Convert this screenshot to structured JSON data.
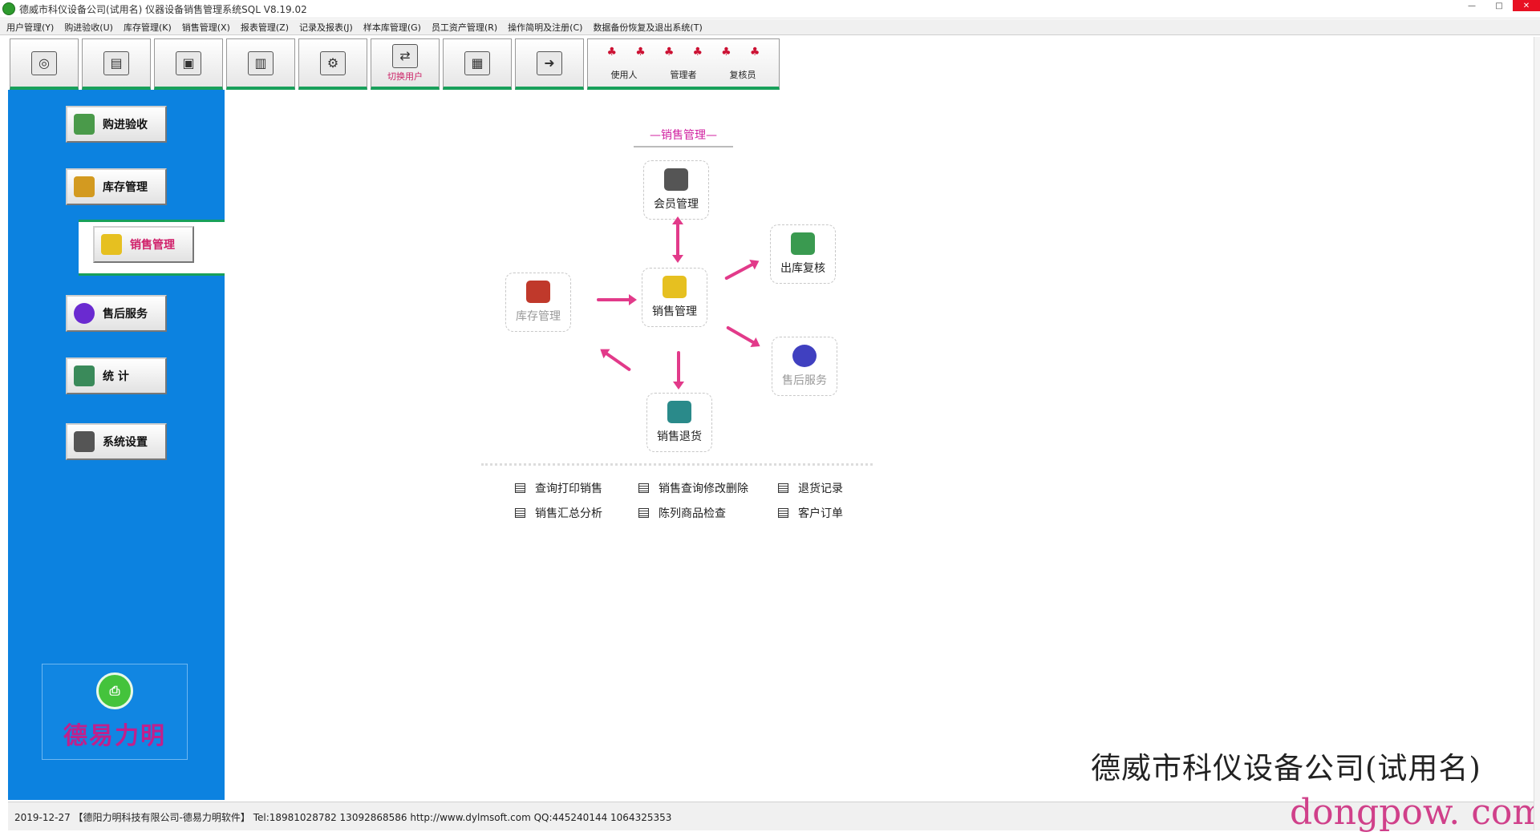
{
  "window": {
    "title": "德威市科仪设备公司(试用名) 仪器设备销售管理系统SQL V8.19.02"
  },
  "menu": [
    "用户管理(Y)",
    "购进验收(U)",
    "库存管理(K)",
    "销售管理(X)",
    "报表管理(Z)",
    "记录及报表(J)",
    "样本库管理(G)",
    "员工资产管理(R)",
    "操作简明及注册(C)",
    "数据备份恢复及退出系统(T)"
  ],
  "toolbar": {
    "buttons": [
      {
        "icon": "globe-icon",
        "glyph": "◎",
        "label": ""
      },
      {
        "icon": "ledger-icon",
        "glyph": "▤",
        "label": ""
      },
      {
        "icon": "box-icon",
        "glyph": "▣",
        "label": ""
      },
      {
        "icon": "form-icon",
        "glyph": "▥",
        "label": ""
      },
      {
        "icon": "tools-icon",
        "glyph": "⚙",
        "label": ""
      },
      {
        "icon": "switch-user-icon",
        "glyph": "⇄",
        "label": "切换用户"
      },
      {
        "icon": "building-icon",
        "glyph": "▦",
        "label": ""
      },
      {
        "icon": "exit-icon",
        "glyph": "➜",
        "label": ""
      }
    ],
    "user_group": {
      "glyphs": [
        "♣",
        "♣",
        "♣",
        "♣",
        "♣",
        "♣"
      ],
      "labels": [
        "使用人",
        "管理者",
        "复核员"
      ]
    }
  },
  "sidebar": {
    "items": [
      {
        "label": "购进验收",
        "icon": "purchase-icon",
        "color": "#4a9a4a"
      },
      {
        "label": "库存管理",
        "icon": "stock-icon",
        "color": "#d39a20"
      },
      {
        "label": "销售管理",
        "icon": "cart-icon",
        "color": "#e6c020"
      },
      {
        "label": "售后服务",
        "icon": "service-icon",
        "color": "#6a2ad0"
      },
      {
        "label": "统  计",
        "icon": "stats-icon",
        "color": "#3a8a5a"
      },
      {
        "label": "系统设置",
        "icon": "settings-icon",
        "color": "#555555"
      }
    ],
    "promo_text": "德易力明"
  },
  "diagram": {
    "title": "—销售管理—",
    "nodes": {
      "member": {
        "label": "会员管理",
        "color": "#555555"
      },
      "center": {
        "label": "销售管理",
        "color": "#e6c020"
      },
      "outbound": {
        "label": "出库复核",
        "color": "#3a9a50"
      },
      "stock": {
        "label": "库存管理",
        "color": "#c0392b"
      },
      "service": {
        "label": "售后服务",
        "color": "#4040c0"
      },
      "returns": {
        "label": "销售退货",
        "color": "#2a8a8a"
      }
    }
  },
  "links": [
    "查询打印销售",
    "销售查询修改删除",
    "退货记录",
    "销售汇总分析",
    "陈列商品检查",
    "客户订单"
  ],
  "company_name": "德威市科仪设备公司(试用名)",
  "status": {
    "text": "2019-12-27 【德阳力明科技有限公司-德易力明软件】 Tel:18981028782 13092868586 http://www.dylmsoft.com QQ:445240144 1064325353"
  },
  "watermark": "dongpow. com",
  "colors": {
    "sidebar": "#0c82e0",
    "accent_green": "#18a05a",
    "arrow": "#e23a8a",
    "title_magenta": "#d020a0"
  }
}
